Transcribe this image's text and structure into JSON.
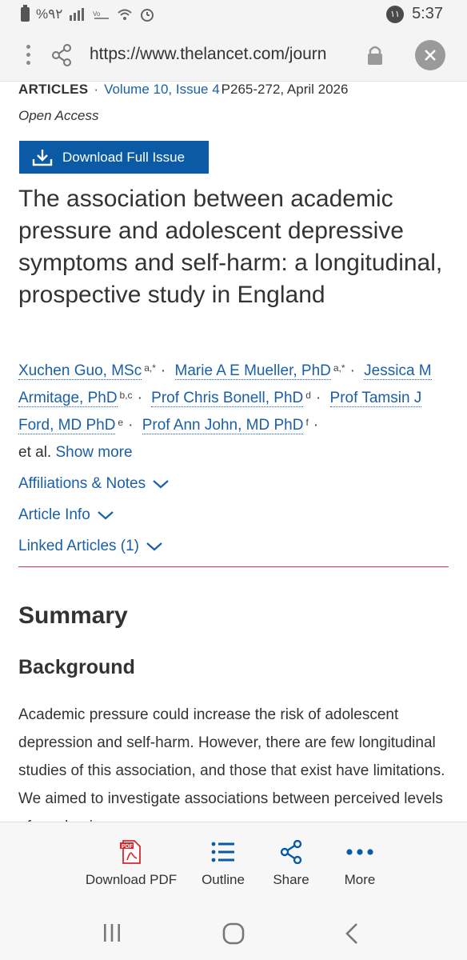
{
  "status_bar": {
    "battery_text": "%۹۲",
    "notification_badge": "۱۱",
    "time": "5:37"
  },
  "browser": {
    "url": "https://www.thelancet.com/journ",
    "icons": [
      "menu-dots-icon",
      "share-icon",
      "lock-icon",
      "close-icon"
    ]
  },
  "article": {
    "type": "ARTICLES",
    "volume": "Volume 10, Issue 4",
    "pages_date": "P265-272, April 2026",
    "access": "Open Access",
    "download_issue_label": "Download Full Issue",
    "title": "The association between academic pressure and adolescent depressive symptoms and self-harm: a longitudinal, prospective study in England",
    "authors": [
      {
        "name": "Xuchen Guo, MSc",
        "sup": "a,*"
      },
      {
        "name": "Marie A E Mueller, PhD",
        "sup": "a,*"
      },
      {
        "name": "Jessica M Armitage, PhD",
        "sup": "b,c"
      },
      {
        "name": "Prof Chris Bonell, PhD",
        "sup": "d"
      },
      {
        "name": "Prof Tamsin J Ford, MD PhD",
        "sup": "e"
      },
      {
        "name": "Prof Ann John, MD PhD",
        "sup": "f"
      }
    ],
    "et_al": "et al.",
    "show_more": "Show more",
    "affiliations_label": "Affiliations & Notes",
    "article_info_label": "Article Info",
    "linked_articles_label": "Linked Articles (1)",
    "summary_heading": "Summary",
    "background_heading": "Background",
    "background_text": "Academic pressure could increase the risk of adolescent depression and self-harm. However, there are few longitudinal studies of this association, and those that exist have limitations. We aimed to investigate associations between perceived levels of academic"
  },
  "toolbar": {
    "download_pdf": "Download PDF",
    "outline": "Outline",
    "share": "Share",
    "more": "More"
  },
  "colors": {
    "link": "#1b5fa7",
    "button": "#0a5aa5",
    "divider": "#c9347a",
    "pdf_red": "#d9272e"
  }
}
